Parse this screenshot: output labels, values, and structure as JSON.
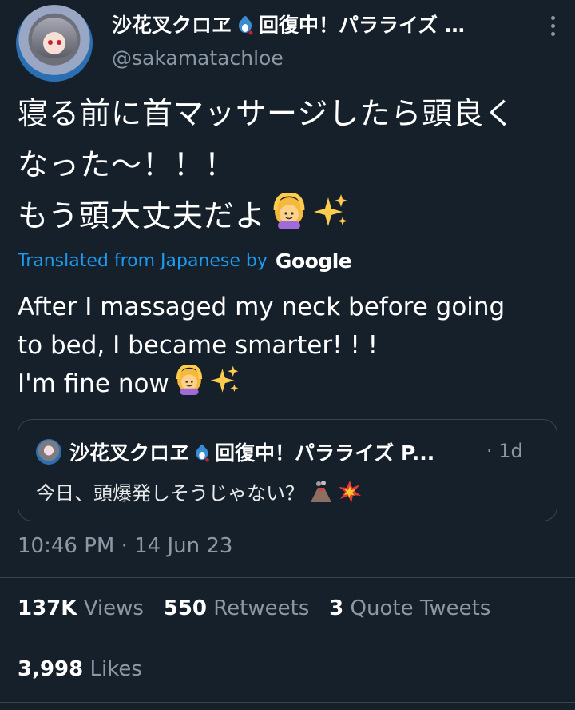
{
  "tweet": {
    "author_name": "沙花叉クロヱ",
    "author_name_suffix": "回復中！パラライズ …",
    "handle": "@sakamatachloe",
    "text_jp_line1": "寝る前に首マッサージしたら頭良く",
    "text_jp_line2": "なった～！！！",
    "text_jp_line3": "もう頭大丈夫だよ",
    "translated_label": "Translated from Japanese by",
    "translated_provider": "Google",
    "text_en_line1": "After I massaged my neck before going",
    "text_en_line2": "to bed, I became smarter! ! !",
    "text_en_line3": "I'm fine now"
  },
  "quote": {
    "author_name": "沙花叉クロヱ",
    "author_name_suffix": "回復中！パラライズ P...",
    "time_sep": "·",
    "time": "1d",
    "text": "今日、頭爆発しそうじゃない？"
  },
  "meta": {
    "timestamp": "10:46 PM · 14 Jun 23",
    "views_count": "137K",
    "views_label": "Views",
    "retweets_count": "550",
    "retweets_label": "Retweets",
    "quotes_count": "3",
    "quotes_label": "Quote Tweets",
    "likes_count": "3,998",
    "likes_label": "Likes"
  },
  "icons": {
    "avatar": "avatar",
    "more": "more-vertical-icon",
    "gesture_ok": "woman-gesturing-ok-emoji",
    "sparkles": "sparkles-emoji",
    "volcano": "volcano-emoji",
    "collision": "collision-emoji",
    "orca": "orca-emoji"
  }
}
